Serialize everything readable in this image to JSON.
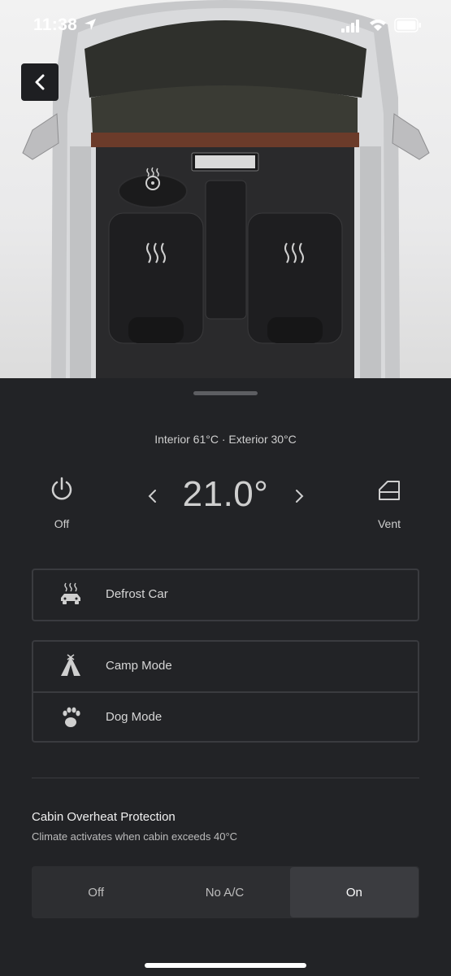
{
  "status_bar": {
    "time": "11:38"
  },
  "climate": {
    "readout": "Interior 61°C  ·  Exterior 30°C",
    "power_label": "Off",
    "temperature": "21.0°",
    "vent_label": "Vent"
  },
  "options": [
    {
      "label": "Defrost Car",
      "icon": "defrost-car-icon"
    },
    {
      "label": "Camp Mode",
      "icon": "tent-icon"
    },
    {
      "label": "Dog Mode",
      "icon": "paw-icon"
    }
  ],
  "cabin_overheat": {
    "title": "Cabin Overheat Protection",
    "subtitle": "Climate activates when cabin exceeds 40°C",
    "segments": [
      "Off",
      "No A/C",
      "On"
    ],
    "selected": "On"
  }
}
